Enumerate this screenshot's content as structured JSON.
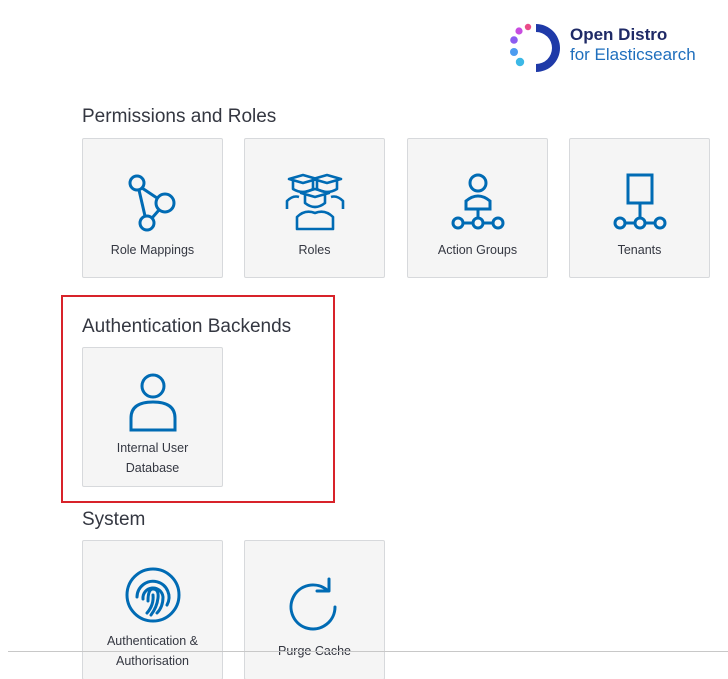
{
  "brand": {
    "line1": "Open Distro",
    "line2": "for Elasticsearch",
    "logo_icon": "open-distro-logo-icon",
    "dot_colors": [
      "#ea4c89",
      "#a64cf0",
      "#4c9cf0",
      "#3ccfcf"
    ],
    "arc_color": "#1f3aa8"
  },
  "sections": {
    "permissions": {
      "title": "Permissions and Roles",
      "tiles": [
        {
          "label": "Role Mappings",
          "icon": "role-mappings-icon"
        },
        {
          "label": "Roles",
          "icon": "roles-icon"
        },
        {
          "label": "Action Groups",
          "icon": "action-groups-icon"
        },
        {
          "label": "Tenants",
          "icon": "tenants-icon"
        }
      ]
    },
    "authentication": {
      "title": "Authentication Backends",
      "tiles": [
        {
          "label_line1": "Internal User",
          "label_line2": "Database",
          "icon": "user-icon"
        }
      ]
    },
    "system": {
      "title": "System",
      "tiles": [
        {
          "label_line1": "Authentication &",
          "label_line2": "Authorisation",
          "icon": "fingerprint-icon"
        },
        {
          "label": "Purge Cache",
          "icon": "refresh-icon"
        }
      ]
    }
  },
  "colors": {
    "icon": "#006bb4",
    "highlight_border": "#d8232a",
    "tile_bg": "#f5f5f5"
  }
}
